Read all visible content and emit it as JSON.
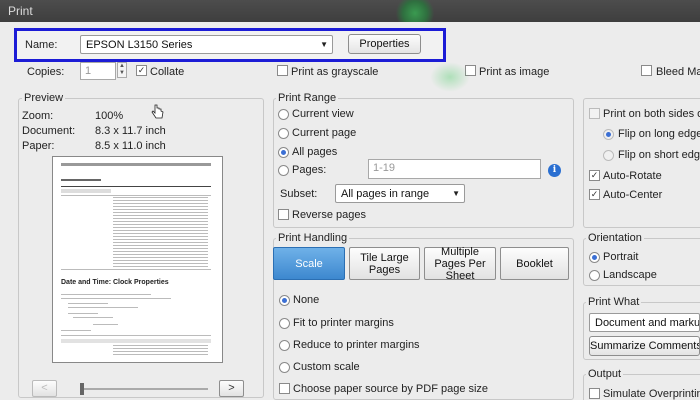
{
  "window": {
    "title": "Print"
  },
  "printer": {
    "name_label": "Name:",
    "name_value": "EPSON L3150 Series",
    "properties_label": "Properties",
    "copies_label": "Copies:",
    "copies_value": "1",
    "collate_label": "Collate",
    "grayscale_label": "Print as grayscale",
    "image_label": "Print as image",
    "bleed_label": "Bleed Ma"
  },
  "preview": {
    "title": "Preview",
    "zoom_label": "Zoom:",
    "zoom_value": "100%",
    "document_label": "Document:",
    "document_value": "8.3 x 11.7 inch",
    "paper_label": "Paper:",
    "paper_value": "8.5 x 11.0 inch",
    "page_heading": "Date and Time: Clock Properties",
    "prev_label": "<",
    "next_label": ">"
  },
  "print_range": {
    "title": "Print Range",
    "current_view": "Current view",
    "current_page": "Current page",
    "all_pages": "All pages",
    "pages_label": "Pages:",
    "pages_placeholder": "1-19",
    "subset_label": "Subset:",
    "subset_value": "All pages in range",
    "reverse_label": "Reverse pages"
  },
  "print_handling": {
    "title": "Print Handling",
    "buttons": [
      "Scale",
      "Tile Large Pages",
      "Multiple Pages Per Sheet",
      "Booklet"
    ],
    "options": [
      "None",
      "Fit to printer margins",
      "Reduce to printer margins",
      "Custom scale"
    ],
    "paper_source_label": "Choose paper source by PDF page size"
  },
  "duplex": {
    "both_sides": "Print on both sides o",
    "long_edge": "Flip on long edge",
    "short_edge": "Flip on short edge",
    "auto_rotate": "Auto-Rotate",
    "auto_center": "Auto-Center"
  },
  "orientation": {
    "title": "Orientation",
    "portrait": "Portrait",
    "landscape": "Landscape"
  },
  "print_what": {
    "title": "Print What",
    "value": "Document and markups",
    "summarize_label": "Summarize Comments"
  },
  "output": {
    "title": "Output",
    "simulate_label": "Simulate Overprinting"
  },
  "colors": {
    "highlight": "#1c1cd6",
    "accent": "#3d88cf"
  }
}
